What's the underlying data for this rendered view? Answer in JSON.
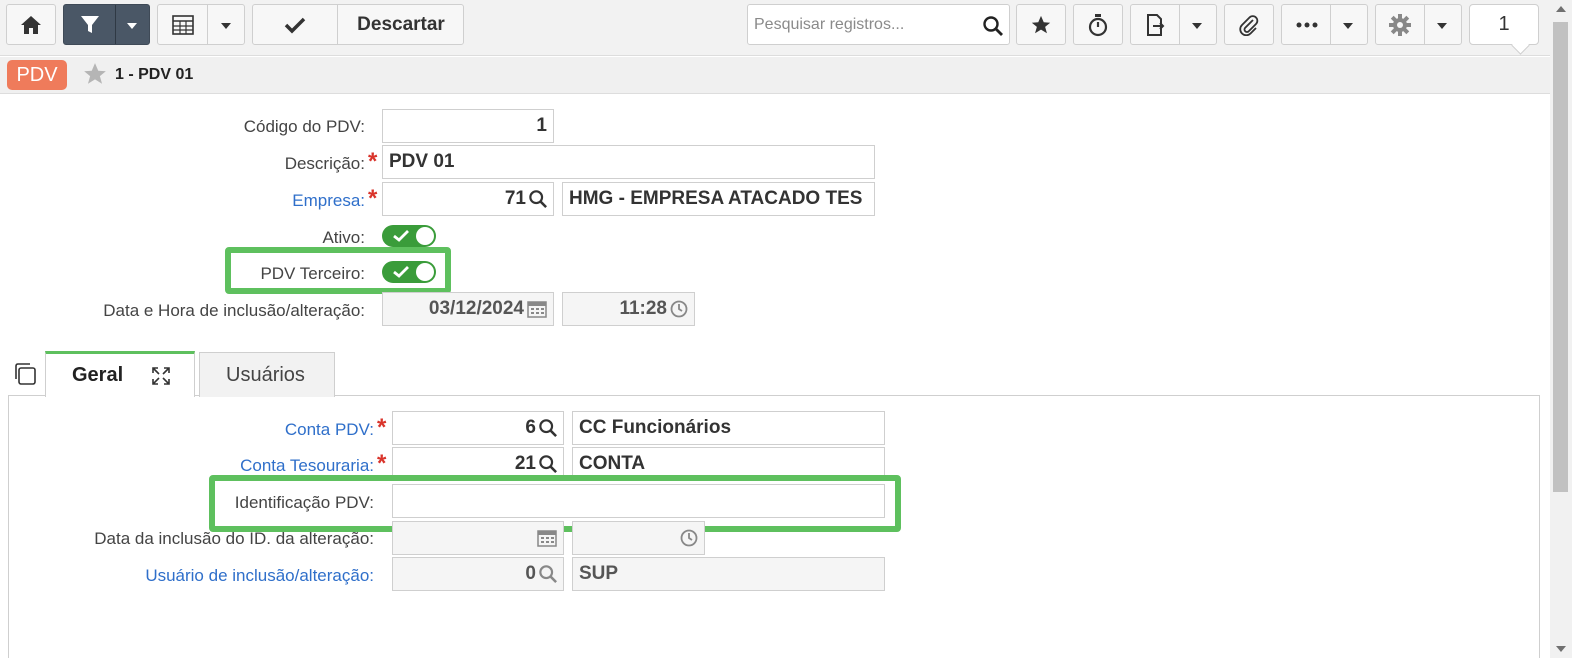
{
  "toolbar": {
    "discard_label": "Descartar",
    "search_placeholder": "Pesquisar registros...",
    "page_number": "1"
  },
  "record": {
    "badge": "PDV",
    "title": "1 - PDV 01"
  },
  "form": {
    "codigo_label": "Código do PDV:",
    "codigo_value": "1",
    "descricao_label": "Descrição:",
    "descricao_value": "PDV 01",
    "empresa_label": "Empresa:",
    "empresa_code": "71",
    "empresa_name": "HMG - EMPRESA ATACADO TES",
    "ativo_label": "Ativo:",
    "ativo_on": true,
    "terceiro_label": "PDV Terceiro:",
    "terceiro_on": true,
    "datahora_label": "Data e Hora de inclusão/alteração:",
    "data_value": "03/12/2024",
    "hora_value": "11:28"
  },
  "tabs": [
    {
      "label": "Geral",
      "active": true
    },
    {
      "label": "Usuários",
      "active": false
    }
  ],
  "geral": {
    "conta_pdv_label": "Conta PDV:",
    "conta_pdv_code": "6",
    "conta_pdv_name": "CC Funcionários",
    "conta_tes_label": "Conta Tesouraria:",
    "conta_tes_code": "21",
    "conta_tes_name": "CONTA",
    "ident_label": "Identificação PDV:",
    "ident_value": "",
    "data_inclusao_label": "Data da inclusão do ID. da alteração:",
    "data_inclusao_date": "",
    "data_inclusao_time": "",
    "usuario_label": "Usuário de inclusão/alteração:",
    "usuario_code": "0",
    "usuario_name": "SUP"
  },
  "colors": {
    "accent_green": "#5ec05e",
    "toggle_green": "#3a9c3a",
    "badge_orange": "#ef7b5b",
    "link_blue": "#2f6fca",
    "required_red": "#d9342b"
  }
}
